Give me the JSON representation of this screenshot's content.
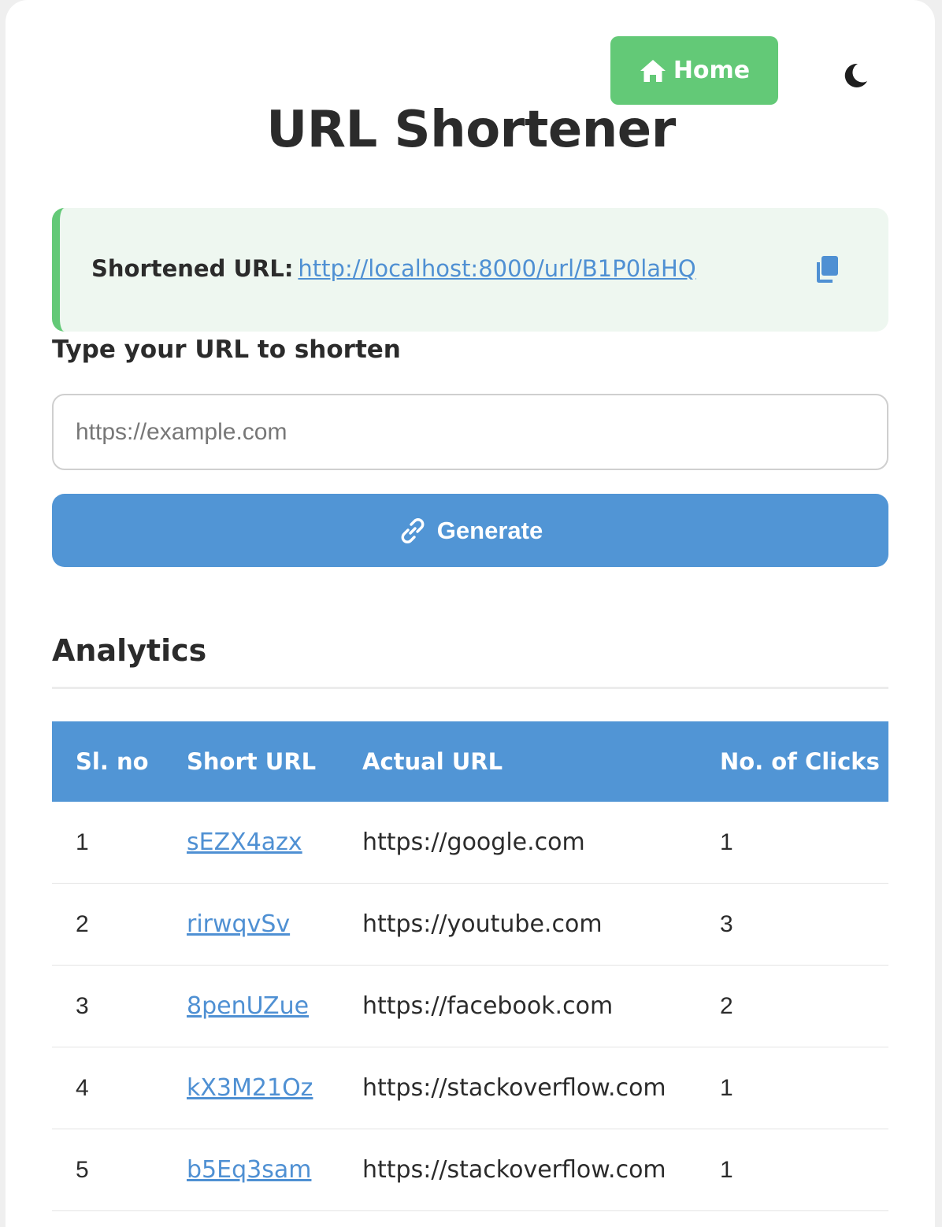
{
  "header": {
    "home_label": "Home",
    "theme_icon": "moon-icon",
    "title": "URL Shortener"
  },
  "result": {
    "label": "Shortened URL:",
    "url": "http://localhost:8000/url/B1P0laHQ",
    "copy_icon": "copy-icon"
  },
  "form": {
    "label": "Type your URL to shorten",
    "placeholder": "https://example.com",
    "value": "",
    "generate_label": "Generate"
  },
  "analytics": {
    "title": "Analytics",
    "columns": [
      "Sl. no",
      "Short URL",
      "Actual URL",
      "No. of Clicks"
    ],
    "rows": [
      {
        "sl": "1",
        "short": "sEZX4azx",
        "actual": "https://google.com",
        "clicks": "1"
      },
      {
        "sl": "2",
        "short": "rirwqvSv",
        "actual": "https://youtube.com",
        "clicks": "3"
      },
      {
        "sl": "3",
        "short": "8penUZue",
        "actual": "https://facebook.com",
        "clicks": "2"
      },
      {
        "sl": "4",
        "short": "kX3M21Oz",
        "actual": "https://stackoverflow.com",
        "clicks": "1"
      },
      {
        "sl": "5",
        "short": "b5Eq3sam",
        "actual": "https://stackoverflow.com",
        "clicks": "1"
      }
    ]
  },
  "colors": {
    "accent_green": "#63c977",
    "accent_blue": "#5195d5",
    "link_blue": "#4f90d3",
    "result_bg": "#eef7f0"
  }
}
